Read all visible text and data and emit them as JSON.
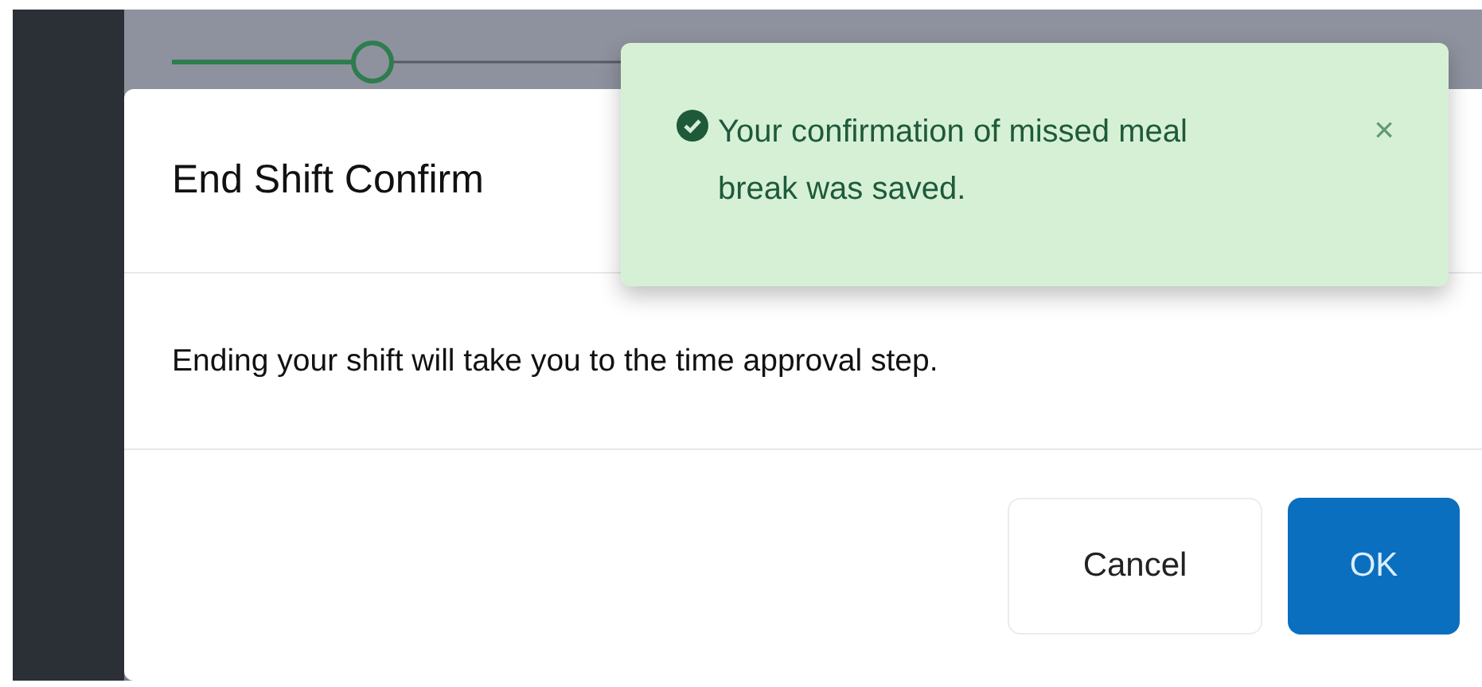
{
  "dialog": {
    "title": "End Shift Confirm",
    "message": "Ending your shift will take you to the time approval step.",
    "buttons": [
      {
        "label": "Cancel",
        "kind": "secondary"
      },
      {
        "label": "OK",
        "kind": "primary"
      }
    ]
  },
  "toast": {
    "kind": "success",
    "message": "Your confirmation of missed meal break was saved.",
    "close": "×"
  }
}
